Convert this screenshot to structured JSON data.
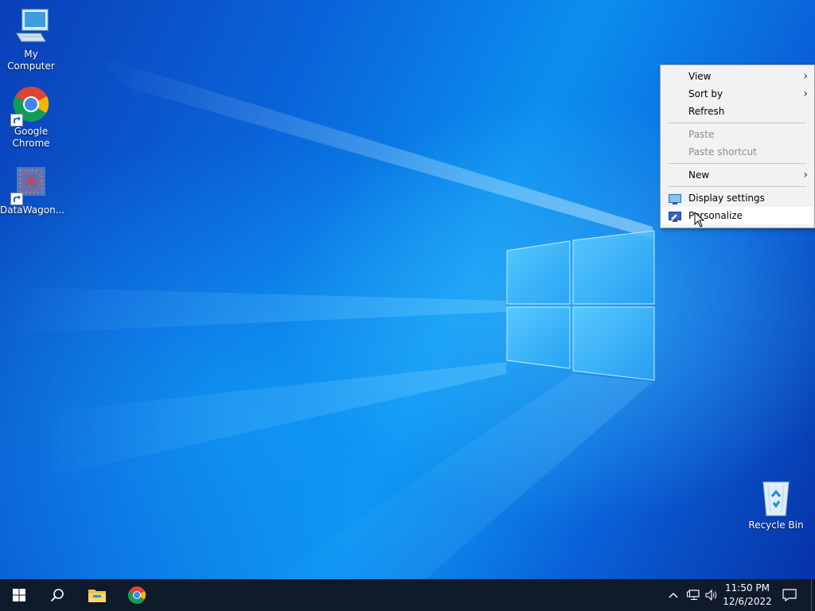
{
  "desktop": {
    "icons": [
      {
        "label": "My Computer"
      },
      {
        "label": "Google Chrome"
      },
      {
        "label": "DataWagon..."
      },
      {
        "label": "Recycle Bin"
      }
    ]
  },
  "context_menu": {
    "items": [
      {
        "label": "View",
        "has_submenu": true,
        "enabled": true
      },
      {
        "label": "Sort by",
        "has_submenu": true,
        "enabled": true
      },
      {
        "label": "Refresh",
        "enabled": true
      },
      {
        "label": "Paste",
        "enabled": false
      },
      {
        "label": "Paste shortcut",
        "enabled": false
      },
      {
        "label": "New",
        "has_submenu": true,
        "enabled": true
      },
      {
        "label": "Display settings",
        "icon": "display-icon",
        "enabled": true
      },
      {
        "label": "Personalize",
        "icon": "personalize-icon",
        "enabled": true,
        "hovered": true
      }
    ]
  },
  "taskbar": {
    "start_icon": "windows-logo-icon",
    "search_icon": "search-icon",
    "pinned": [
      "file-explorer-icon",
      "chrome-icon"
    ],
    "tray_icons": [
      "chevron-up-icon",
      "network-icon",
      "volume-icon"
    ],
    "clock": {
      "time": "11:50 PM",
      "date": "12/6/2022"
    },
    "notification_icon": "action-center-icon"
  },
  "colors": {
    "taskbar": "#0f1a2b",
    "menu_bg": "#f2f2f2",
    "wallpaper_accent": "#0b8ff0"
  }
}
